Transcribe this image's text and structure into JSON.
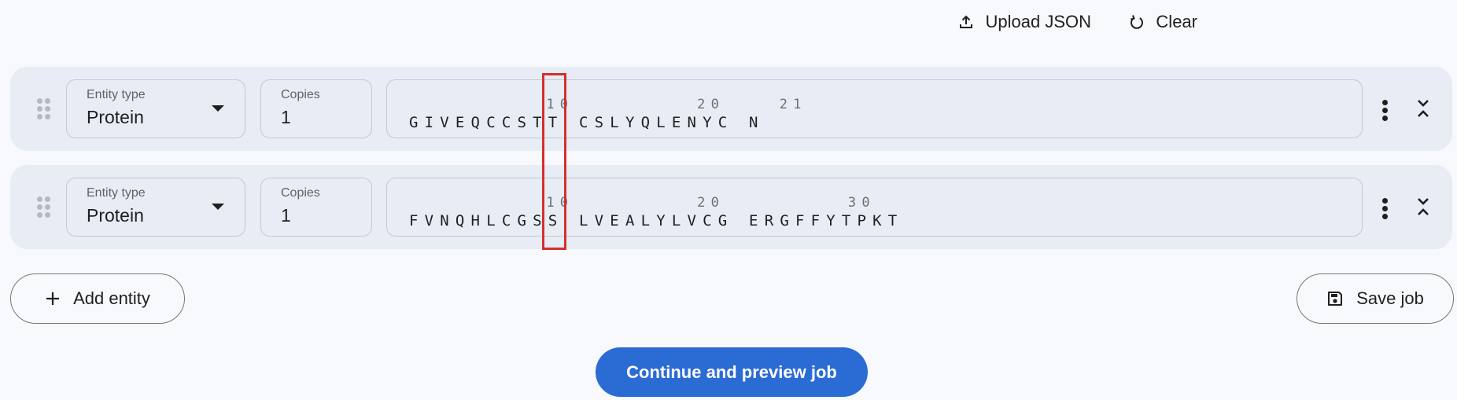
{
  "toolbar": {
    "upload_label": "Upload JSON",
    "upload_icon": "upload-icon",
    "clear_label": "Clear",
    "clear_icon": "refresh-icon"
  },
  "entities": [
    {
      "type_label": "Entity type",
      "type_value": "Protein",
      "copies_label": "Copies",
      "copies_value": "1",
      "sequence_numbers": "          10         20    21",
      "sequence": "GIVEQCCSTT CSLYQLENYC N"
    },
    {
      "type_label": "Entity type",
      "type_value": "Protein",
      "copies_label": "Copies",
      "copies_value": "1",
      "sequence_numbers": "          10         20         30",
      "sequence": "FVNQHLCGSS LVEALYLVCG ERGFFYTPKT"
    }
  ],
  "actions": {
    "add_entity_label": "Add entity",
    "save_job_label": "Save job",
    "continue_label": "Continue and preview job"
  },
  "colors": {
    "primary": "#2b6bd4",
    "row_background": "#e8ecf4",
    "page_background": "#f8f9fc",
    "highlight": "#d32f2f"
  }
}
